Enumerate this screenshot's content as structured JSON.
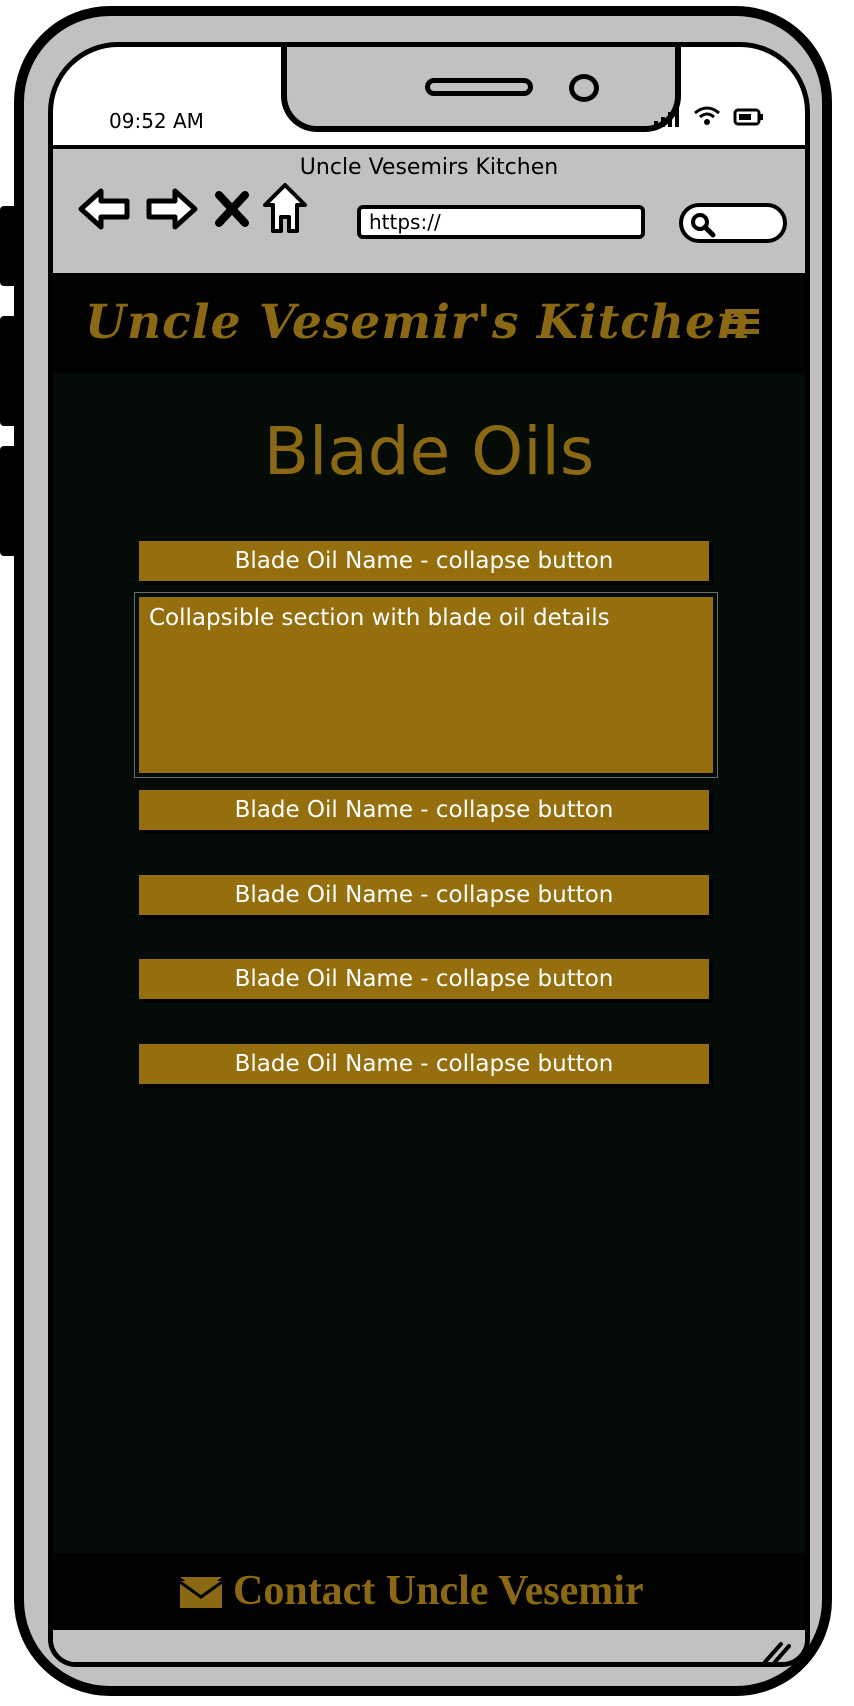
{
  "status_bar": {
    "time": "09:52 AM"
  },
  "browser": {
    "title": "Uncle Vesemirs Kitchen",
    "url": "https://"
  },
  "site": {
    "logo_text": "Uncle Vesemir's Kitchen",
    "page_title": "Blade Oils",
    "accent_color": "#8b6914",
    "button_color": "#956f0d",
    "background_color": "#050b06"
  },
  "blade_oils": {
    "items": [
      {
        "label": "Blade Oil Name - collapse button"
      },
      {
        "label": "Blade Oil Name - collapse button"
      },
      {
        "label": "Blade Oil Name - collapse button"
      },
      {
        "label": "Blade Oil Name - collapse button"
      },
      {
        "label": "Blade Oil Name - collapse button"
      }
    ],
    "expanded_panel_text": "Collapsible section with blade oil details"
  },
  "footer": {
    "contact_label": "Contact Uncle Vesemir"
  },
  "icons": {
    "back": "back-arrow-icon",
    "forward": "forward-arrow-icon",
    "stop": "close-icon",
    "home": "home-icon",
    "search": "search-icon",
    "menu": "hamburger-menu-icon",
    "contact": "envelope-icon",
    "signal": "signal-icon",
    "wifi": "wifi-icon",
    "battery": "battery-icon",
    "resize": "resize-handle-icon"
  }
}
